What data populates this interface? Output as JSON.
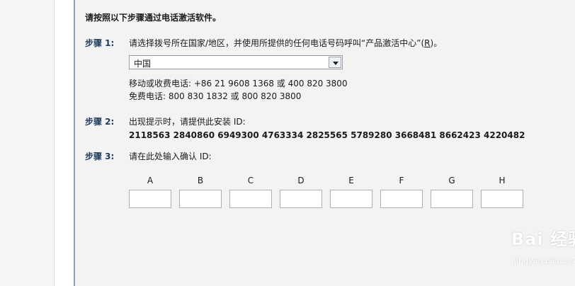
{
  "headline": "请按照以下步骤通过电话激活软件。",
  "step1": {
    "label": "步骤 1:",
    "text_before": "请选择拨号所在国家/地区，并使用所提供的任何电话号码呼叫“产品激活中心”(",
    "mnemonic": "R",
    "text_after": ")。"
  },
  "country_select": {
    "value": "中国",
    "icon": "chevron-down-icon"
  },
  "phones": {
    "mobile": "移动或收费电话: +86 21 9608 1368 或 400 820 3800",
    "tollfree": "免费电话: 800 830 1832 或 800 820 3800"
  },
  "step2": {
    "label": "步骤 2:",
    "text": "出现提示时，请提供此安装 ID:",
    "installation_id": "2118563  2840860  6949300  4763334  2825565  5789280  3668481  8662423  4220482"
  },
  "step3": {
    "label": "步骤 3:",
    "text": "请在此处输入确认 ID:"
  },
  "confirmation_columns": [
    "A",
    "B",
    "C",
    "D",
    "E",
    "F",
    "G",
    "H"
  ],
  "watermark": {
    "text": "Bai 经验",
    "url": "jingyan.baidu.com"
  }
}
